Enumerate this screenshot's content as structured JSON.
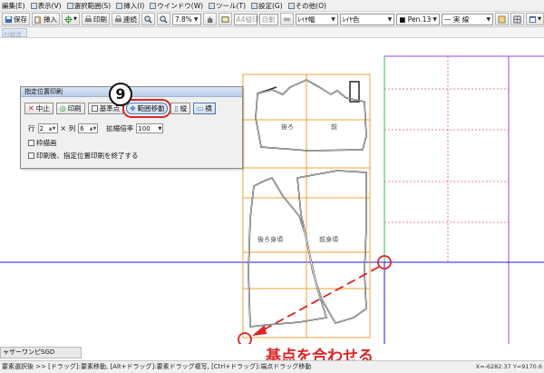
{
  "menubar": [
    "編集(E)",
    "表示(V)",
    "選択範囲(S)",
    "挿入(I)",
    "ウインドウ(W)",
    "ツール(T)",
    "設定(G)",
    "その他(O)"
  ],
  "toolbar": {
    "save": "保存",
    "insert": "挿入",
    "print": "印刷",
    "continuous": "連続",
    "zoom_value": "7.8%",
    "paper": "A4縦印",
    "auto": "自動",
    "layer_width": "ﾚｲﾔ幅",
    "layer_color": "ﾚｲﾔ色",
    "pen": "Pen.13",
    "line_type": "実 線"
  },
  "subbar_ghost": "ﾔﾏ線消",
  "dialog": {
    "title": "指定位置印刷",
    "buttons": {
      "cancel": "中止",
      "print": "印刷",
      "base_point": "基準点",
      "range_move": "範囲移動",
      "portrait": "縦",
      "landscape": "横"
    },
    "row_label": "行",
    "row_value": "2",
    "times": "×",
    "col_label": "列",
    "col_value": "6",
    "scale_label": "拡縮倍率",
    "scale_value": "100",
    "check_frame": "枠描画",
    "check_end": "印刷後、指定位置印刷を終了する"
  },
  "pattern_labels": {
    "back": "後ろ",
    "front": "前",
    "back_body": "後ろ身頃",
    "front_body": "前身頃"
  },
  "annotation_step": "9",
  "annotation_text": "基点を合わせる",
  "status": {
    "doc_tab": "ャザーワンピSGD",
    "hint": "要素選択後 >> [ドラッグ]:要素移動, [Alt+ドラッグ]:要素ドラッグ複写, [Ctrl+ドラッグ]:端点ドラッグ移動",
    "coords": "X=-6282.37  Y=9170.6"
  },
  "colors": {
    "highlight": "#e02424",
    "grid_orange": "#f0a030",
    "guide_blue": "#1a1ad8",
    "guide_green": "#29c35a",
    "guide_purple": "#a040d8",
    "pink_dot": "#e05a7a"
  }
}
